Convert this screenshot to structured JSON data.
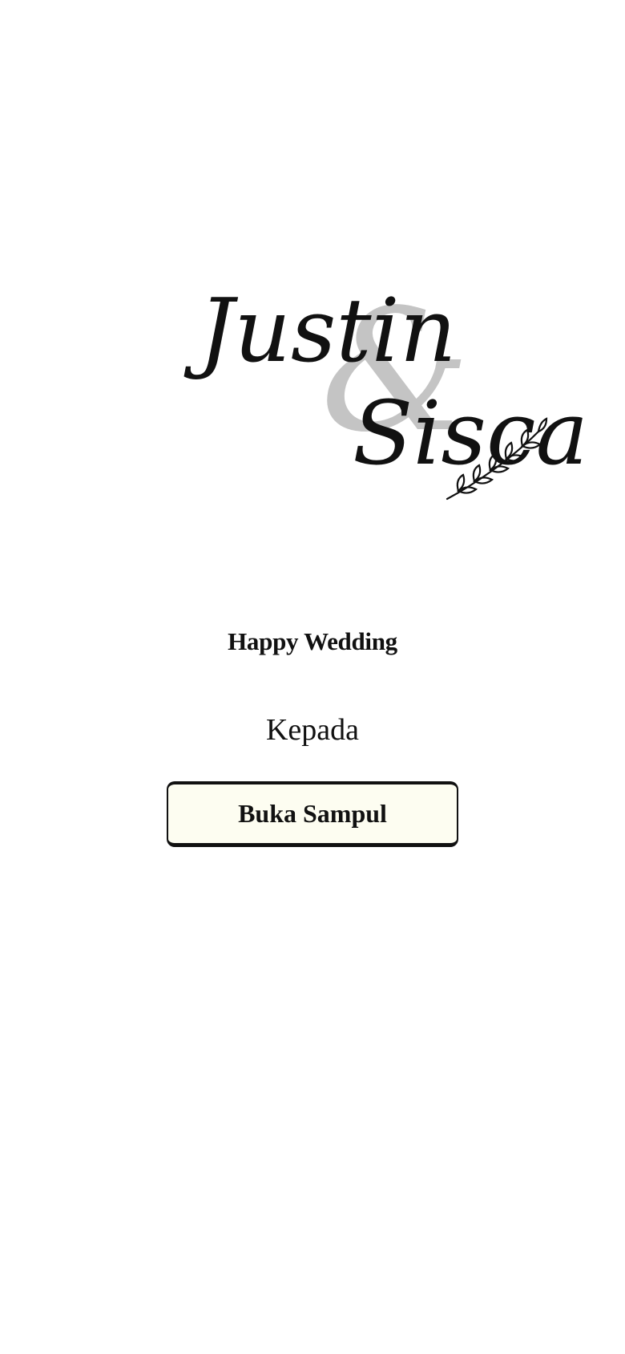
{
  "invitation": {
    "couple": {
      "first_name": "Justin",
      "ampersand": "&",
      "second_name": "Sisca"
    },
    "subtitle": "Happy Wedding",
    "recipient_label": "Kepada",
    "open_button_label": "Buka Sampul"
  },
  "colors": {
    "background": "#ffffff",
    "text": "#111111",
    "ampersand": "#c4c4c4",
    "button_background": "#fdfdf1",
    "button_border": "#111111"
  },
  "icons": {
    "decoration": "leaf-branch-icon"
  }
}
